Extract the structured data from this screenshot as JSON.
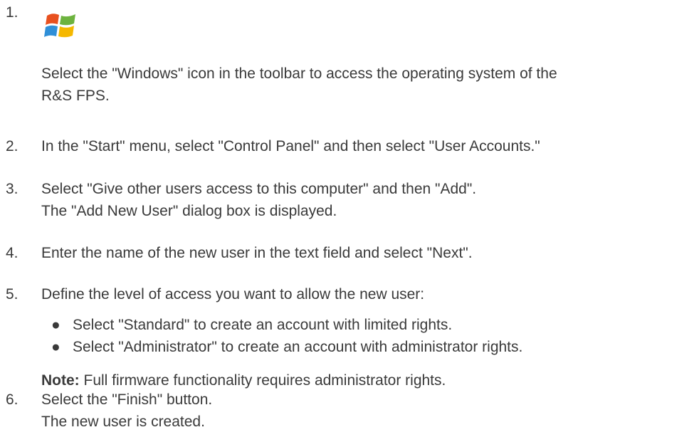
{
  "steps": [
    {
      "number": "1.",
      "icon": "windows-logo-icon",
      "lines": [
        "Select the \"Windows\" icon in the toolbar to access the operating system of the",
        "R&S FPS."
      ]
    },
    {
      "number": "2.",
      "lines": [
        "In the \"Start\" menu, select \"Control Panel\" and then select \"User Accounts.\""
      ]
    },
    {
      "number": "3.",
      "lines": [
        "Select \"Give other users access to this computer\" and then \"Add\".",
        "The \"Add New User\" dialog box is displayed."
      ]
    },
    {
      "number": "4.",
      "lines": [
        "Enter the name of the new user in the text field and select \"Next\"."
      ]
    },
    {
      "number": "5.",
      "lines": [
        "Define the level of access you want to allow the new user:"
      ],
      "bullets": [
        "Select \"Standard\" to create an account with limited rights.",
        "Select \"Administrator\" to create an account with administrator rights."
      ],
      "note": {
        "label": "Note:",
        "text": " Full firmware functionality requires administrator rights."
      }
    },
    {
      "number": "6.",
      "lines": [
        "Select the \"Finish\" button.",
        "The new user is created."
      ]
    }
  ],
  "bullet_glyph": "●",
  "colors": {
    "text": "#3a3a3a",
    "logo_red": "#e8501f",
    "logo_green": "#6db33f",
    "logo_blue": "#2f8fd8",
    "logo_yellow": "#f5b800"
  }
}
